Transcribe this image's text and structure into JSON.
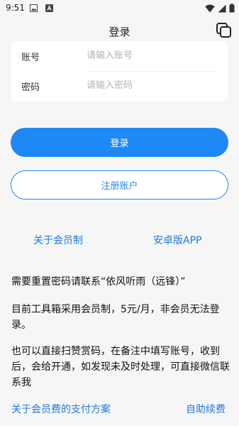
{
  "status_bar": {
    "time": "9:51"
  },
  "app_bar": {
    "title": "登录"
  },
  "form": {
    "account_label": "账号",
    "account_placeholder": "请输入账号",
    "password_label": "密码",
    "password_placeholder": "请输入密码"
  },
  "buttons": {
    "login": "登录",
    "register": "注册账户"
  },
  "links": {
    "membership_about": "关于会员制",
    "android_app": "安卓版APP",
    "payment_plan": "关于会员费的支付方案",
    "self_renew": "自助续费"
  },
  "notices": {
    "reset_password": "需要重置密码请联系“依风听雨（远锋）”",
    "membership_info": "目前工具箱采用会员制，5元/月，非会员无法登录。",
    "tip_info": "也可以直接扫赞赏码，在备注中填写账号，收到后，会给开通，如发现未及时处理，可直接微信联系我"
  },
  "colors": {
    "accent": "#1e88f5",
    "link": "#1e78e6",
    "background": "#f6f6f6"
  }
}
